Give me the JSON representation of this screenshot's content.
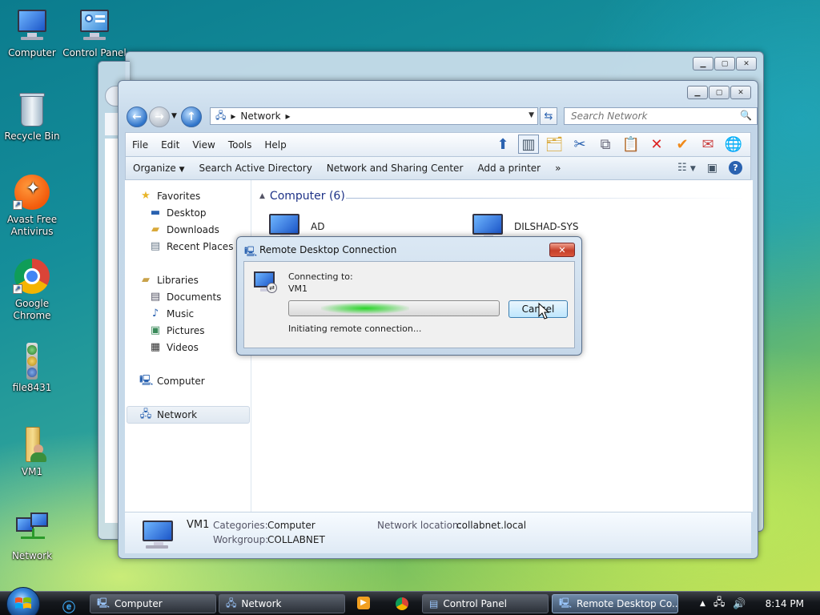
{
  "desktop": {
    "icons": [
      {
        "label": "Computer"
      },
      {
        "label": "Control Panel"
      },
      {
        "label": "Recycle Bin"
      },
      {
        "label_line1": "Avast Free",
        "label_line2": "Antivirus"
      },
      {
        "label_line1": "Google",
        "label_line2": "Chrome"
      },
      {
        "label": "file8431"
      },
      {
        "label": "VM1"
      },
      {
        "label": "Network"
      }
    ]
  },
  "network_window": {
    "address": {
      "root_arrow": "▸",
      "location": "Network",
      "end_arrow": "▸"
    },
    "search_placeholder": "Search Network",
    "menu": [
      "File",
      "Edit",
      "View",
      "Tools",
      "Help"
    ],
    "commands": [
      "Organize",
      "Search Active Directory",
      "Network and Sharing Center",
      "Add a printer"
    ],
    "more": "»",
    "nav": {
      "favorites": "Favorites",
      "desktop": "Desktop",
      "downloads": "Downloads",
      "recent": "Recent Places",
      "libraries": "Libraries",
      "documents": "Documents",
      "music": "Music",
      "pictures": "Pictures",
      "videos": "Videos",
      "computer": "Computer",
      "network": "Network"
    },
    "group": {
      "title": "Computer (6)"
    },
    "computers": [
      "AD",
      "DILSHAD-SYS"
    ],
    "details": {
      "name": "VM1",
      "categories_label": "Categories:",
      "categories_value": "Computer",
      "workgroup_label": "Workgroup:",
      "workgroup_value": "COLLABNET",
      "location_label": "Network location:",
      "location_value": "collabnet.local"
    }
  },
  "rdc_dialog": {
    "title": "Remote Desktop Connection",
    "connecting_to": "Connecting to:",
    "target": "VM1",
    "status": "Initiating remote connection...",
    "cancel_label": "Cancel"
  },
  "taskbar": {
    "tasks": [
      "Computer",
      "Network",
      "Control Panel",
      "Remote Desktop Co..."
    ],
    "clock": "8:14 PM"
  },
  "colors": {
    "accent": "#1e3287",
    "taskbar": "#15181d"
  }
}
